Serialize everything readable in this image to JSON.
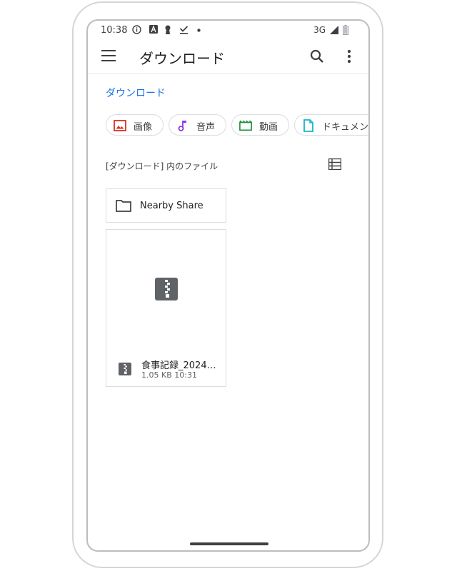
{
  "status_bar": {
    "time": "10:38",
    "network": "3G",
    "icons": [
      "info-icon",
      "a-icon",
      "keyhole-icon",
      "download-done-icon",
      "dot-icon",
      "signal-icon",
      "battery-icon"
    ]
  },
  "app_bar": {
    "title": "ダウンロード",
    "icons": [
      "menu-icon",
      "search-icon",
      "more-vert-icon"
    ]
  },
  "breadcrumb": "ダウンロード",
  "chips": [
    {
      "label": "画像",
      "icon": "image-icon",
      "color": "#d93025"
    },
    {
      "label": "音声",
      "icon": "music-note-icon",
      "color": "#9334e6"
    },
    {
      "label": "動画",
      "icon": "movie-icon",
      "color": "#1e8e3e"
    },
    {
      "label": "ドキュメン",
      "icon": "document-icon",
      "color": "#12b5cb"
    }
  ],
  "section": {
    "label": "[ダウンロード] 内のファイル",
    "view_icon": "list-view-icon"
  },
  "folders": [
    {
      "name": "Nearby Share",
      "icon": "folder-icon"
    }
  ],
  "files": [
    {
      "name": "食事記録_2024…",
      "size": "1.05 KB",
      "time": "10:31",
      "icon": "zip-icon",
      "size_time": "1.05 KB 10:31"
    }
  ],
  "colors": {
    "accent": "#1a73e8",
    "zip_icon": "#5f6368"
  }
}
